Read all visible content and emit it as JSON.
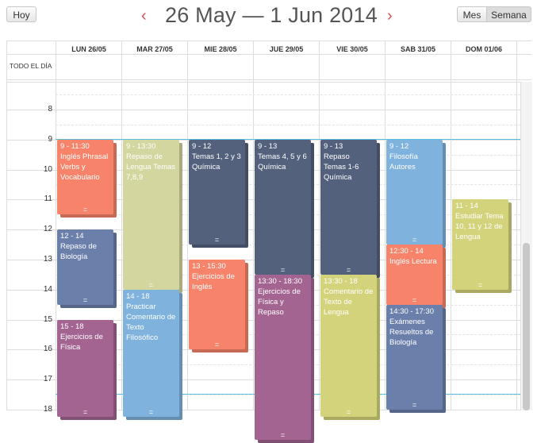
{
  "toolbar": {
    "today_label": "Hoy",
    "title": "26 May — 1 Jun 2014",
    "prev_symbol": "‹",
    "next_symbol": "›",
    "month_label": "Mes",
    "week_label": "Semana"
  },
  "allday_label": "TODO EL DÍA",
  "columns": [
    "LUN 26/05",
    "MAR 27/05",
    "MIE 28/05",
    "JUE 29/05",
    "VIE 30/05",
    "SAB 31/05",
    "DOM 01/06"
  ],
  "hours": [
    "8",
    "9",
    "10",
    "11",
    "12",
    "13",
    "14",
    "15",
    "16",
    "17",
    "18"
  ],
  "grip": "=",
  "colors": {
    "orange": "#f7846a",
    "khaki": "#d3d69e",
    "navy": "#54617d",
    "sky": "#7fb2dc",
    "slate": "#6b7fab",
    "plum": "#a36492",
    "olive": "#d3d37b",
    "accent": "#d9534f",
    "now_line": "#5bc0de"
  },
  "events": [
    {
      "day": 0,
      "start": 9,
      "end": 11,
      "color": "orange",
      "time": "9 - 11:30",
      "text": "Inglés Phrasal Verbs y Vocabulario"
    },
    {
      "day": 0,
      "start": 12,
      "end": 14,
      "color": "slate",
      "time": "12 - 14",
      "text": "Repaso de Biología"
    },
    {
      "day": 0,
      "start": 15,
      "end": 17.75,
      "color": "plum",
      "time": "15 - 18",
      "text": "Ejercicios de Física"
    },
    {
      "day": 1,
      "start": 9,
      "end": 13.5,
      "color": "khaki",
      "time": "9 - 13:30",
      "text": "Repaso de Lengua Temas 7,8,9"
    },
    {
      "day": 1,
      "start": 14,
      "end": 17.75,
      "color": "sky",
      "time": "14 - 18",
      "text": "Practicar Comentario de Texto Filosófico"
    },
    {
      "day": 2,
      "start": 9,
      "end": 12,
      "color": "navy",
      "time": "9 - 12",
      "text": "Temas 1, 2 y 3 Química"
    },
    {
      "day": 2,
      "start": 13,
      "end": 15.5,
      "color": "orange",
      "time": "13 - 15:30",
      "text": "Ejercicios de Inglés"
    },
    {
      "day": 3,
      "start": 9,
      "end": 13,
      "color": "navy",
      "time": "9 - 13",
      "text": "Temas 4, 5 y 6 Química"
    },
    {
      "day": 3,
      "start": 13.5,
      "end": 18.5,
      "color": "plum",
      "time": "13:30 - 18:30",
      "text": "Ejercicios de Física y Repaso"
    },
    {
      "day": 4,
      "start": 9,
      "end": 13,
      "color": "navy",
      "time": "9 - 13",
      "text": "Repaso Temas 1-6 Química"
    },
    {
      "day": 4,
      "start": 13.5,
      "end": 17.75,
      "color": "olive",
      "time": "13:30 - 18",
      "text": "Comentario de Texto de Lengua"
    },
    {
      "day": 5,
      "start": 9,
      "end": 12,
      "color": "sky",
      "time": "9 - 12",
      "text": "Filosofía Autores"
    },
    {
      "day": 5,
      "start": 12.5,
      "end": 14,
      "color": "orange",
      "time": "12:30 - 14",
      "text": "Inglés Lectura"
    },
    {
      "day": 5,
      "start": 14.5,
      "end": 17.5,
      "color": "slate",
      "time": "14:30 - 17:30",
      "text": "Exámenes Resueltos de Biología"
    },
    {
      "day": 6,
      "start": 11,
      "end": 13.5,
      "color": "olive",
      "time": "11 - 14",
      "text": "Estudiar Tema 10, 11 y 12 de Lengua"
    }
  ]
}
